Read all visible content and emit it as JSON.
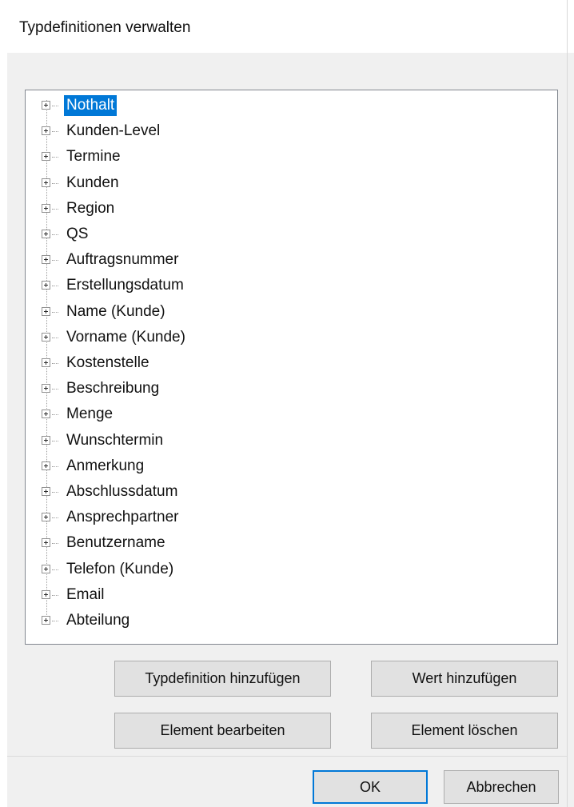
{
  "window": {
    "title": "Typdefinitionen verwalten"
  },
  "tree": {
    "selected_index": 0,
    "items": [
      {
        "label": "Nothalt"
      },
      {
        "label": "Kunden-Level"
      },
      {
        "label": "Termine"
      },
      {
        "label": "Kunden"
      },
      {
        "label": "Region"
      },
      {
        "label": "QS"
      },
      {
        "label": "Auftragsnummer"
      },
      {
        "label": "Erstellungsdatum"
      },
      {
        "label": "Name (Kunde)"
      },
      {
        "label": "Vorname (Kunde)"
      },
      {
        "label": "Kostenstelle"
      },
      {
        "label": "Beschreibung"
      },
      {
        "label": "Menge"
      },
      {
        "label": "Wunschtermin"
      },
      {
        "label": "Anmerkung"
      },
      {
        "label": "Abschlussdatum"
      },
      {
        "label": "Ansprechpartner"
      },
      {
        "label": "Benutzername"
      },
      {
        "label": "Telefon (Kunde)"
      },
      {
        "label": "Email"
      },
      {
        "label": "Abteilung"
      }
    ]
  },
  "buttons": {
    "add_type": "Typdefinition hinzufügen",
    "add_value": "Wert hinzufügen",
    "edit_element": "Element bearbeiten",
    "delete_element": "Element löschen",
    "ok": "OK",
    "cancel": "Abbrechen"
  },
  "colors": {
    "selection": "#0078d7",
    "dialog_background": "#f0f0f0",
    "button_background": "#e1e1e1"
  },
  "icons": {
    "expander": "plus-box-icon"
  }
}
